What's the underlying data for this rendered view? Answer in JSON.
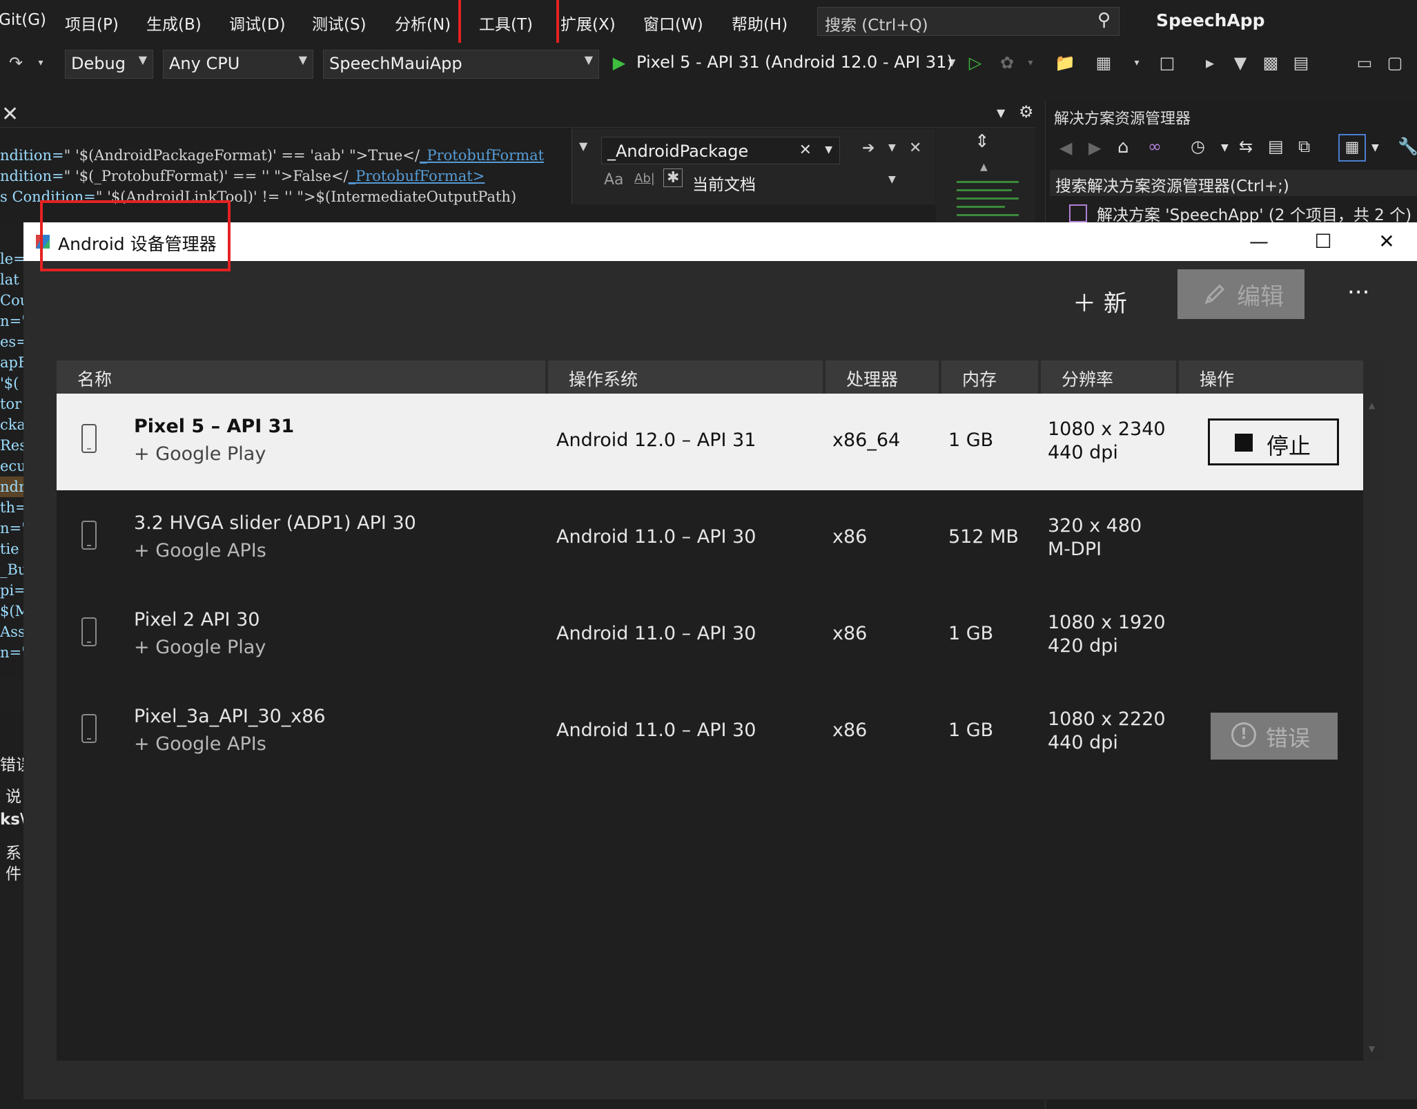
{
  "menu": {
    "items": [
      "Git(G)",
      "项目(P)",
      "生成(B)",
      "调试(D)",
      "测试(S)",
      "分析(N)",
      "工具(T)",
      "扩展(X)",
      "窗口(W)",
      "帮助(H)"
    ],
    "search_placeholder": "搜索 (Ctrl+Q)",
    "app_title": "SpeechApp"
  },
  "toolbar": {
    "config": "Debug",
    "platform": "Any CPU",
    "startup_project": "SpeechMauiApp",
    "run_target": "Pixel 5 - API 31 (Android 12.0 - API 31)"
  },
  "editor": {
    "code_lines": [
      {
        "a": "ndition=",
        "b": "\" '$(AndroidPackageFormat)' == 'aab' \">True</",
        "c": "_ProtobufFormat"
      },
      {
        "a": "ndition=",
        "b": "\" '$(_ProtobufFormat)' == '' \">False</",
        "c": "_ProtobufFormat>"
      },
      {
        "a": "s Condition=",
        "b": "\" '$(AndroidLinkTool)' != '' \">$(IntermediateOutputPath)",
        "c": ""
      }
    ],
    "left_fragments": [
      "le=",
      "lat",
      "Cou",
      "n=\"",
      "es=",
      "apF",
      "'$(",
      "tor",
      "cka",
      "Res",
      "ecu",
      "ndr",
      "th=",
      "n=\"",
      "tie",
      "_Bu",
      "pi=",
      "$(M",
      "Ass",
      "n=\""
    ],
    "find_text": "_AndroidPackage",
    "find_scope": "当前文档",
    "find_opt_case": "Aa",
    "find_opt_word": "Ab|"
  },
  "left_panels": [
    "错误",
    "说",
    "ks\\",
    "系",
    "件"
  ],
  "solution_explorer": {
    "title": "解决方案资源管理器",
    "search": "搜索解决方案资源管理器(Ctrl+;)",
    "tree_root": "解决方案 'SpeechApp' (2 个项目，共 2 个)"
  },
  "adm": {
    "title": "Android 设备管理器",
    "new_label": "新",
    "edit_label": "编辑",
    "more_label": "...",
    "columns": [
      "名称",
      "操作系统",
      "处理器",
      "内存",
      "分辨率",
      "操作"
    ],
    "devices": [
      {
        "name": "Pixel 5 – API 31",
        "sub": "+ Google Play",
        "os": "Android 12.0 – API 31",
        "cpu": "x86_64",
        "mem": "1 GB",
        "res": "1080 x 2340",
        "dpi": "440 dpi",
        "action": "停止"
      },
      {
        "name": "3.2  HVGA slider (ADP1) API 30",
        "sub": "+ Google APIs",
        "os": "Android 11.0 – API 30",
        "cpu": "x86",
        "mem": "512 MB",
        "res": "320 x 480",
        "dpi": "M-DPI",
        "action": ""
      },
      {
        "name": "Pixel 2 API 30",
        "sub": "+ Google Play",
        "os": "Android 11.0 – API 30",
        "cpu": "x86",
        "mem": "1 GB",
        "res": "1080 x 1920",
        "dpi": "420 dpi",
        "action": ""
      },
      {
        "name": "Pixel_3a_API_30_x86",
        "sub": "+ Google APIs",
        "os": "Android 11.0 – API 30",
        "cpu": "x86",
        "mem": "1 GB",
        "res": "1080 x 2220",
        "dpi": "440 dpi",
        "action": "错误"
      }
    ]
  },
  "colors": {
    "highlight": "#e52222",
    "selected_row": "#f0f0f0",
    "run_green": "#3fbf3f"
  }
}
